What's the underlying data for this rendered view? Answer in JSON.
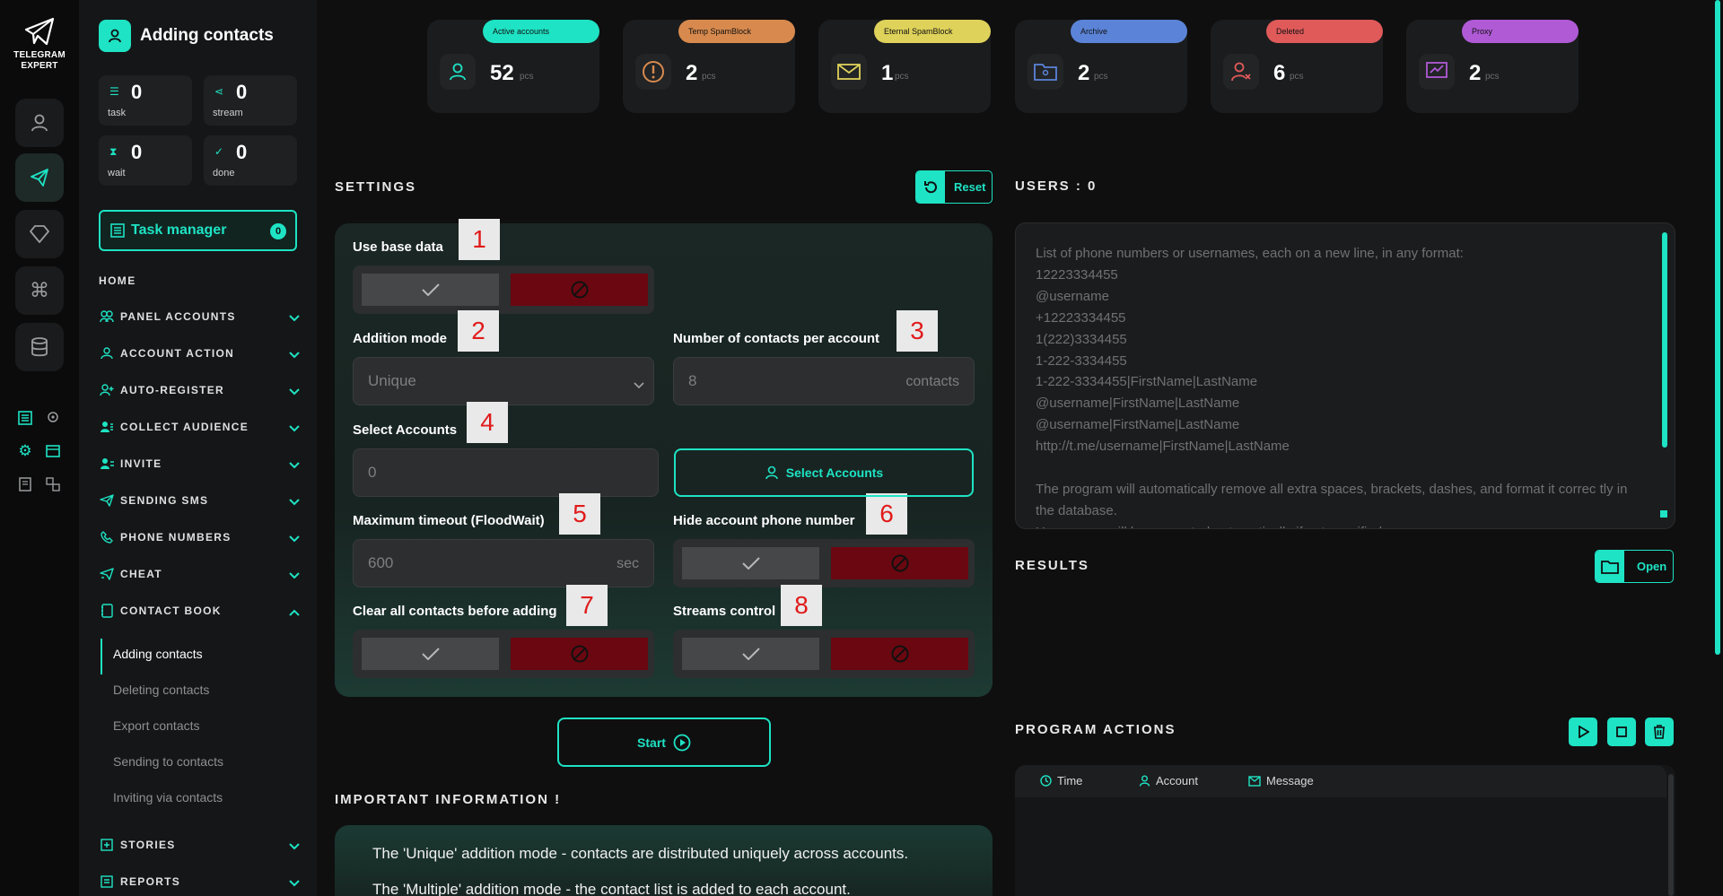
{
  "brand": {
    "line1": "TELEGRAM",
    "line2": "EXPERT"
  },
  "page": {
    "title": "Adding contacts"
  },
  "stats": [
    {
      "icon": "task-icon",
      "value": "0",
      "label": "task"
    },
    {
      "icon": "stream-icon",
      "value": "0",
      "label": "stream"
    },
    {
      "icon": "hourglass-icon",
      "value": "0",
      "label": "wait"
    },
    {
      "icon": "done-icon",
      "value": "0",
      "label": "done"
    }
  ],
  "task_manager": {
    "label": "Task manager",
    "count": "0"
  },
  "nav": {
    "home": "HOME",
    "items": [
      {
        "label": "PANEL ACCOUNTS",
        "icon": "accounts-icon"
      },
      {
        "label": "ACCOUNT ACTION",
        "icon": "user-icon"
      },
      {
        "label": "AUTO-REGISTER",
        "icon": "user-plus-icon"
      },
      {
        "label": "COLLECT AUDIENCE",
        "icon": "audience-icon"
      },
      {
        "label": "INVITE",
        "icon": "invite-icon"
      },
      {
        "label": "SENDING SMS",
        "icon": "send-icon"
      },
      {
        "label": "PHONE NUMBERS",
        "icon": "phone-icon"
      },
      {
        "label": "CHEAT",
        "icon": "cheat-icon"
      },
      {
        "label": "CONTACT BOOK",
        "icon": "contact-book-icon"
      },
      {
        "label": "STORIES",
        "icon": "stories-icon"
      },
      {
        "label": "REPORTS",
        "icon": "reports-icon"
      }
    ],
    "contact_book_sub": [
      "Adding contacts",
      "Deleting contacts",
      "Export contacts",
      "Sending to contacts",
      "Inviting via contacts"
    ]
  },
  "cards": [
    {
      "tag": "Active accounts",
      "value": "52",
      "unit": "pcs",
      "color": "#1ee3c4"
    },
    {
      "tag": "Temp SpamBlock",
      "value": "2",
      "unit": "pcs",
      "color": "#d88a4e"
    },
    {
      "tag": "Eternal SpamBlock",
      "value": "1",
      "unit": "pcs",
      "color": "#dfd25a"
    },
    {
      "tag": "Archive",
      "value": "2",
      "unit": "pcs",
      "color": "#5b84d8"
    },
    {
      "tag": "Deleted",
      "value": "6",
      "unit": "pcs",
      "color": "#e05a5a"
    },
    {
      "tag": "Proxy",
      "value": "2",
      "unit": "pcs",
      "color": "#b05ad6"
    }
  ],
  "settings": {
    "title": "SETTINGS",
    "reset": "Reset",
    "use_base_data": "Use base data",
    "addition_mode": "Addition mode",
    "addition_mode_value": "Unique",
    "contacts_per_account": "Number of contacts per account",
    "contacts_per_account_value": "8",
    "contacts_unit": "contacts",
    "select_accounts": "Select Accounts",
    "select_accounts_value": "0",
    "select_accounts_button": "Select Accounts",
    "max_timeout": "Maximum timeout (FloodWait)",
    "max_timeout_value": "600",
    "max_timeout_unit": "sec",
    "hide_phone": "Hide account phone number",
    "clear_contacts": "Clear all contacts before adding",
    "streams_control": "Streams control",
    "markers": [
      "1",
      "2",
      "3",
      "4",
      "5",
      "6",
      "7",
      "8"
    ]
  },
  "start": "Start",
  "important": {
    "title": "IMPORTANT INFORMATION !",
    "line1": "The 'Unique' addition mode - contacts are distributed uniquely across accounts.",
    "line2": "The 'Multiple' addition mode - the contact list is added to each account."
  },
  "users": {
    "title": "USERS : 0",
    "placeholder_lines": [
      "List of phone numbers or usernames, each on a new line, in any format:",
      "12223334455",
      "@username",
      "+12223334455",
      "1(222)3334455",
      "1-222-3334455",
      "1-222-3334455|FirstName|LastName",
      "@username|FirstName|LastName",
      "@username|FirstName|LastName",
      "http://t.me/username|FirstName|LastName",
      "",
      "The program will automatically remove all extra spaces, brackets, dashes, and format it correc tly in the database.",
      "Usernames will be generated automatically if not specified."
    ]
  },
  "results": {
    "title": "RESULTS",
    "open": "Open"
  },
  "program_actions": {
    "title": "PROGRAM ACTIONS",
    "columns": [
      "Time",
      "Account",
      "Message"
    ]
  },
  "accent": "#1ee3c4",
  "deny_color": "#6b0710"
}
